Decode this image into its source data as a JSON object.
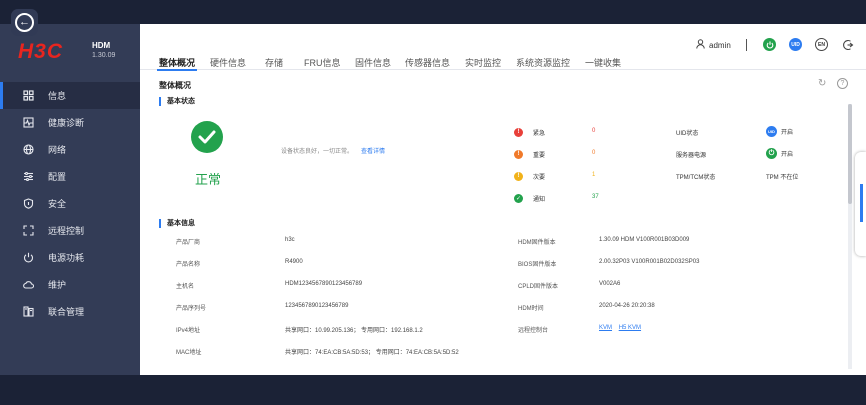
{
  "header": {
    "logo_mark": "H3C",
    "product": "HDM",
    "version": "1.30.09",
    "user": "admin",
    "uid_badge": "UID",
    "lang_badge": "EN"
  },
  "sidebar": {
    "items": [
      {
        "label": "信息",
        "icon": "grid-icon",
        "active": true
      },
      {
        "label": "健康诊断",
        "icon": "heartbeat-icon"
      },
      {
        "label": "网络",
        "icon": "globe-icon"
      },
      {
        "label": "配置",
        "icon": "sliders-icon"
      },
      {
        "label": "安全",
        "icon": "shield-icon"
      },
      {
        "label": "远程控制",
        "icon": "remote-icon"
      },
      {
        "label": "电源功耗",
        "icon": "power-icon"
      },
      {
        "label": "维护",
        "icon": "cloud-icon"
      },
      {
        "label": "联合管理",
        "icon": "server-icon"
      }
    ]
  },
  "tabs": [
    "整体概况",
    "硬件信息",
    "存储",
    "FRU信息",
    "固件信息",
    "传感器信息",
    "实时监控",
    "系统资源监控",
    "一键收集"
  ],
  "overview": {
    "title": "整体概况",
    "basic_status_title": "基本状态",
    "status_text": "正常",
    "status_desc": "设备状态良好，一切正常。",
    "status_link": "查看详情",
    "alarms": [
      {
        "label": "紧急",
        "count": "0",
        "color": "#e8403a",
        "glyph": "!"
      },
      {
        "label": "重要",
        "count": "0",
        "color": "#f07a2a",
        "glyph": "!"
      },
      {
        "label": "次要",
        "count": "1",
        "color": "#f1b21a",
        "glyph": "!"
      },
      {
        "label": "通知",
        "count": "37",
        "color": "#23a24d",
        "glyph": "✓"
      }
    ],
    "states": [
      {
        "label": "UID状态",
        "badge": "UID",
        "value": "开启",
        "color": "#2d7cf0"
      },
      {
        "label": "服务器电源",
        "badge": "⏻",
        "value": "开启",
        "color": "#23a24d"
      },
      {
        "label": "TPM/TCM状态",
        "badge": "",
        "value": "TPM 不在位",
        "color": ""
      }
    ]
  },
  "basic_info": {
    "title": "基本信息",
    "left": [
      {
        "label": "产品厂商",
        "value": "h3c"
      },
      {
        "label": "产品名称",
        "value": "R4900"
      },
      {
        "label": "主机名",
        "value": "HDM1234567890123456789"
      },
      {
        "label": "产品序列号",
        "value": "1234567890123456789"
      },
      {
        "label": "IPv4地址",
        "value": "共享网口：10.99.205.136；  专用网口：192.168.1.2"
      },
      {
        "label": "MAC地址",
        "value": "共享网口：74:EA:CB:5A:5D:53；  专用网口：74:EA:CB:5A:5D:52"
      }
    ],
    "right": [
      {
        "label": "HDM固件版本",
        "value": "1.30.09 HDM V100R001B03D009"
      },
      {
        "label": "BIOS固件版本",
        "value": "2.00.32P03 V100R001B02D032SP03"
      },
      {
        "label": "CPLD固件版本",
        "value": "V002A6"
      },
      {
        "label": "HDM时间",
        "value": "2020-04-26 20:20:38"
      },
      {
        "label": "远程控制台",
        "links": [
          "KVM",
          "H5 KVM"
        ]
      }
    ]
  }
}
